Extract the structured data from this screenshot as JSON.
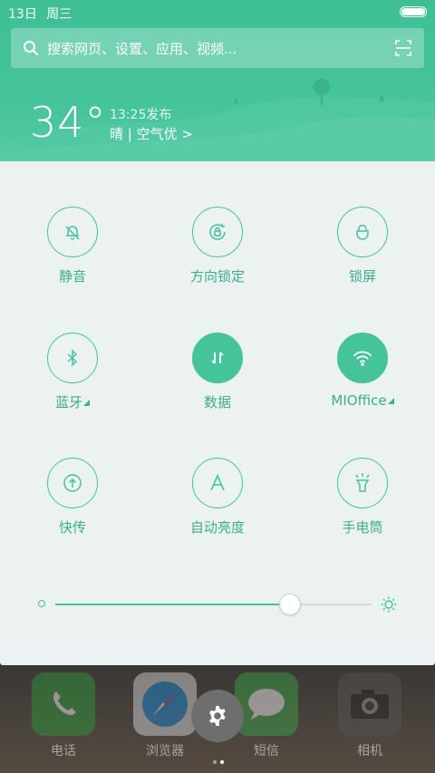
{
  "status_bar": {
    "date": "13日",
    "weekday": "周三"
  },
  "search": {
    "placeholder": "搜索网页、设置、应用、视频...",
    "icon": "search-icon",
    "scan_icon": "scan-icon"
  },
  "weather": {
    "temperature": "34°",
    "publish_time": "13:25发布",
    "condition": "晴 | 空气优 >"
  },
  "toggles": [
    {
      "label": "静音",
      "icon": "mute-bell-icon",
      "active": false,
      "has_more": false
    },
    {
      "label": "方向锁定",
      "icon": "rotation-lock-icon",
      "active": false,
      "has_more": false
    },
    {
      "label": "锁屏",
      "icon": "lock-icon",
      "active": false,
      "has_more": false
    },
    {
      "label": "蓝牙",
      "icon": "bluetooth-icon",
      "active": false,
      "has_more": true
    },
    {
      "label": "数据",
      "icon": "mobile-data-icon",
      "active": true,
      "has_more": false
    },
    {
      "label": "MIOffice",
      "icon": "wifi-icon",
      "active": true,
      "has_more": true
    },
    {
      "label": "快传",
      "icon": "quick-transfer-icon",
      "active": false,
      "has_more": false
    },
    {
      "label": "自动亮度",
      "icon": "auto-brightness-icon",
      "active": false,
      "has_more": false
    },
    {
      "label": "手电筒",
      "icon": "flashlight-icon",
      "active": false,
      "has_more": false
    }
  ],
  "brightness": {
    "level": 0.74
  },
  "dock": [
    {
      "label": "电话",
      "icon": "phone-icon"
    },
    {
      "label": "浏览器",
      "icon": "compass-icon"
    },
    {
      "label": "短信",
      "icon": "message-icon"
    },
    {
      "label": "相机",
      "icon": "camera-icon"
    }
  ],
  "colors": {
    "accent": "#45c39a",
    "panel": "#ecf2f2",
    "label": "#3cae88"
  },
  "page_indicator": {
    "count": 2,
    "active": 1
  }
}
